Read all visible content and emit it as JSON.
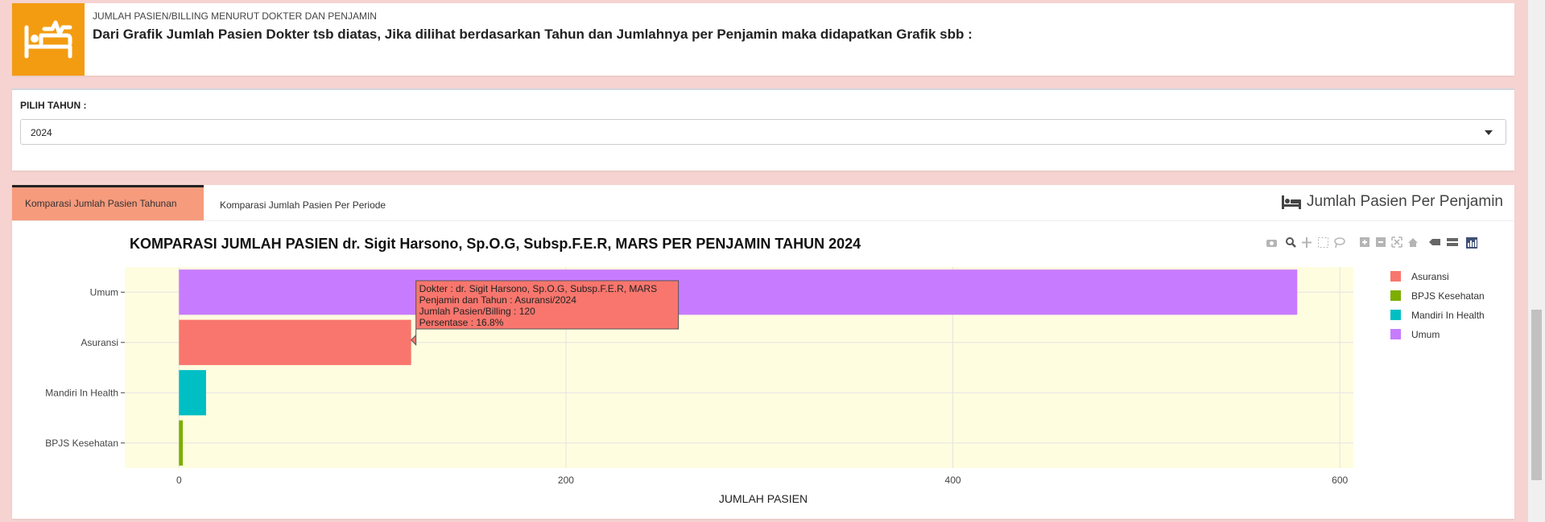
{
  "info": {
    "small": "JUMLAH PASIEN/BILLING MENURUT DOKTER DAN PENJAMIN",
    "main": "Dari Grafik Jumlah Pasien Dokter tsb diatas, Jika dilihat berdasarkan Tahun dan Jumlahnya per Penjamin maka didapatkan Grafik sbb :",
    "icon": "bed-icon",
    "color": "#f39c12"
  },
  "year": {
    "label": "PILIH TAHUN :",
    "value": "2024"
  },
  "tabs": [
    {
      "label": "Komparasi Jumlah Pasien Tahunan",
      "active": true
    },
    {
      "label": "Komparasi Jumlah Pasien Per Periode",
      "active": false
    }
  ],
  "card_title": "Jumlah Pasien Per Penjamin",
  "modebar": [
    "camera-icon",
    "zoom-icon",
    "pan-icon",
    "box-select-icon",
    "lasso-icon",
    "zoom-in-icon",
    "zoom-out-icon",
    "autoscale-icon",
    "reset-axes-icon",
    "spike-icon",
    "compare-icon",
    "plotly-logo-icon"
  ],
  "tooltip": {
    "lines": [
      "Dokter : dr. Sigit Harsono, Sp.O.G, Subsp.F.E.R, MARS",
      "Penjamin dan Tahun : Asuransi/2024",
      "Jumlah Pasien/Billing : 120",
      "Persentase : 16.8%"
    ]
  },
  "chart_data": {
    "type": "bar",
    "orientation": "horizontal",
    "title": "KOMPARASI JUMLAH PASIEN dr. Sigit Harsono, Sp.O.G, Subsp.F.E.R, MARS PER PENJAMIN TAHUN 2024",
    "xlabel": "JUMLAH PASIEN",
    "ylabel": "",
    "xlim": [
      -28,
      607
    ],
    "xticks": [
      0,
      200,
      400,
      600
    ],
    "categories": [
      "Umum",
      "Asuransi",
      "Mandiri In Health",
      "BPJS Kesehatan"
    ],
    "series": [
      {
        "name": "Asuransi",
        "color": "#f8766d",
        "values": [
          0,
          120,
          0,
          0
        ]
      },
      {
        "name": "BPJS Kesehatan",
        "color": "#7cae00",
        "values": [
          0,
          0,
          0,
          2
        ]
      },
      {
        "name": "Mandiri In Health",
        "color": "#00bfc4",
        "values": [
          0,
          0,
          14,
          0
        ]
      },
      {
        "name": "Umum",
        "color": "#c77cff",
        "values": [
          578,
          0,
          0,
          0
        ]
      }
    ],
    "plot_bg": "#fffde0",
    "grid": true,
    "legend": "right"
  }
}
